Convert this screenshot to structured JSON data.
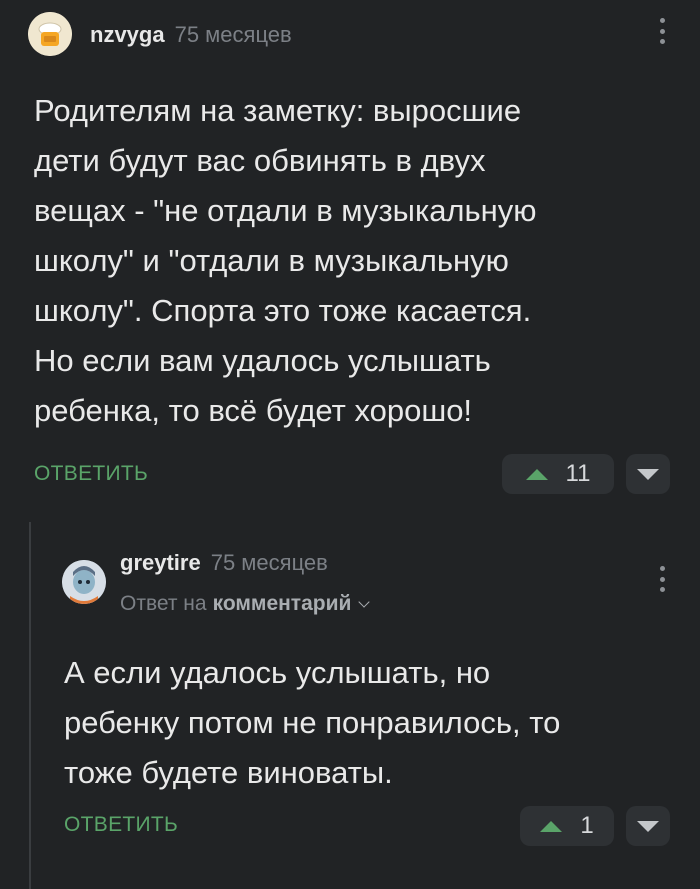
{
  "comment": {
    "username": "nzvyga",
    "time": "75 месяцев",
    "text_lines": [
      "Родителям на заметку: выросшие",
      "дети будут вас обвинять в двух",
      "вещах - \"не отдали в музыкальную",
      "школу\" и \"отдали в музыкальную",
      "школу\". Спорта это тоже касается.",
      "Но если вам удалось услышать",
      "ребенка, то всё будет хорошо!"
    ],
    "reply_label": "ОТВЕТИТЬ",
    "rating": "11"
  },
  "reply": {
    "username": "greytire",
    "time": "75 месяцев",
    "reply_to_prefix": "Ответ на",
    "reply_to_link": "комментарий",
    "text_lines": [
      "А если удалось услышать, но",
      "ребенку потом не понравилось, то",
      "тоже будете виноваты."
    ],
    "reply_label": "ОТВЕТИТЬ",
    "rating": "1"
  },
  "colors": {
    "background": "#212325",
    "accent_green": "#5aa469",
    "muted_text": "#7c8086"
  },
  "icons": [
    "more-vertical-icon",
    "upvote-arrow-icon",
    "downvote-arrow-icon",
    "chevron-down-icon"
  ]
}
